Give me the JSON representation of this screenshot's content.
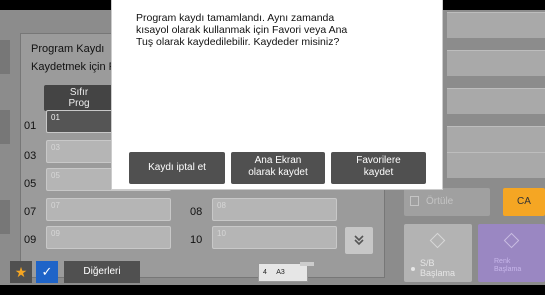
{
  "panel": {
    "title": "Program Kaydı",
    "subtitle": "Kaydetmek için P"
  },
  "reset_button": {
    "line1": "Sıfır",
    "line2": "Prog"
  },
  "rows": [
    {
      "num": "01",
      "label": "01",
      "selected": true
    },
    {
      "num": "03",
      "label": "03",
      "selected": false
    },
    {
      "num": "05",
      "label": "05",
      "selected": false
    },
    {
      "num": "07",
      "label": "07",
      "selected": false
    },
    {
      "num": "08",
      "label": "08",
      "selected": false
    },
    {
      "num": "09",
      "label": "09",
      "selected": false
    },
    {
      "num": "10",
      "label": "10",
      "selected": false
    }
  ],
  "modal": {
    "message": "Program kaydı tamamlandı. Aynı zamanda kısayol olarak kullanmak için Favori veya Ana Tuş olarak kaydedilebilir. Kaydeder misiniz?",
    "cancel_label": "Kaydı iptal et",
    "home_line1": "Ana Ekran",
    "home_line2": "olarak kaydet",
    "fav_line1": "Favorilere",
    "fav_line2": "kaydet"
  },
  "controls": {
    "clear_label": "Örtüle",
    "ca_label": "CA",
    "bw_line1": "S/B",
    "bw_line2": "Başlama",
    "color_line1": "Renk",
    "color_line2": "Başlama"
  },
  "bottom_bar": {
    "star_icon": "★",
    "check_icon": "✓",
    "others_label": "Diğerleri",
    "tray_number": "4",
    "paper_size": "A3"
  },
  "icons": {
    "scroll_down": "double-chevron-down-icon"
  },
  "colors": {
    "accent_orange": "#f5a623",
    "check_blue": "#1f64c8",
    "color_start_purple": "#9a87c2",
    "button_dark": "#505050"
  }
}
